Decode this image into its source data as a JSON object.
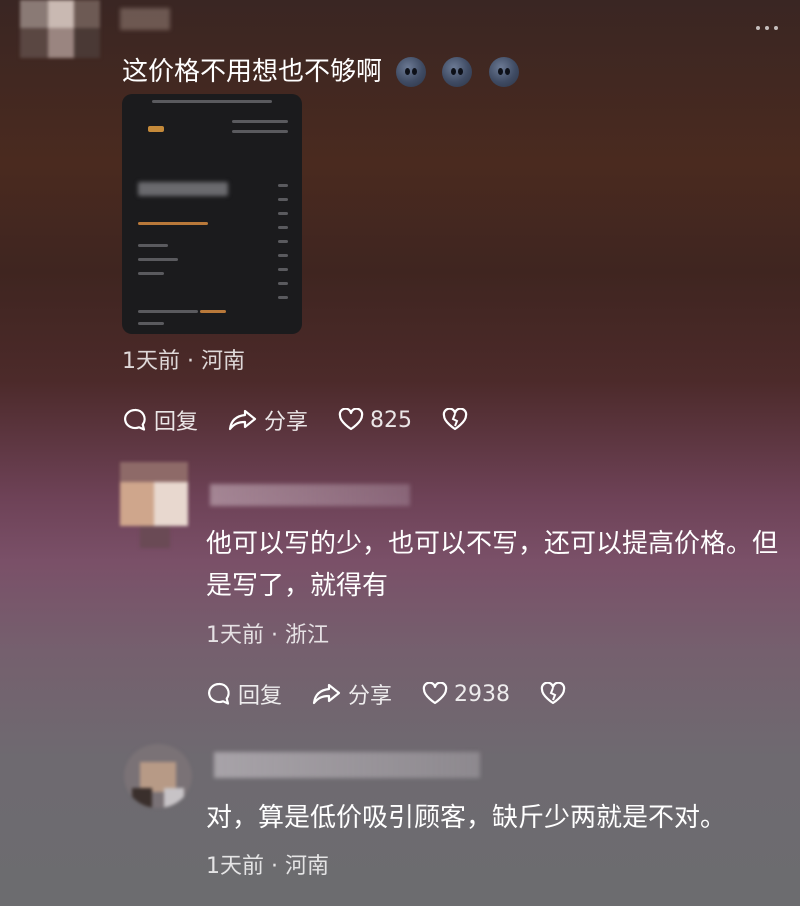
{
  "comments": [
    {
      "text": "这价格不用想也不够啊",
      "emoji_icons": [
        "dizzy-face-icon",
        "dizzy-face-icon",
        "dizzy-face-icon"
      ],
      "meta": "1天前 · 河南",
      "actions": {
        "reply": "回复",
        "share": "分享",
        "likes": "825"
      }
    },
    {
      "text_line1": "他可以写的少，也可以不写，还可以提高价格。但",
      "text_line2": "是写了，就得有",
      "meta": "1天前 · 浙江",
      "actions": {
        "reply": "回复",
        "share": "分享",
        "likes": "2938"
      }
    },
    {
      "text": "对，算是低价吸引顾客，缺斤少两就是不对。",
      "meta": "1天前 · 河南"
    }
  ]
}
